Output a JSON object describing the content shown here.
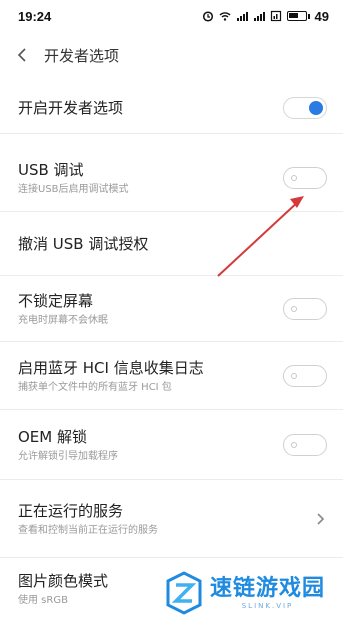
{
  "status_bar": {
    "time": "19:24",
    "battery": "49",
    "icons": [
      "alarm-icon",
      "wifi-icon",
      "signal-icon",
      "signal-icon",
      "signal-icon",
      "battery-icon"
    ]
  },
  "header": {
    "title": "开发者选项",
    "back_icon": "chevron-left-icon"
  },
  "rows": [
    {
      "title": "开启开发者选项",
      "subtitle": "",
      "control": "toggle",
      "on": true
    },
    {
      "title": "USB 调试",
      "subtitle": "连接USB后启用调试模式",
      "control": "toggle",
      "on": false
    },
    {
      "title": "撤消 USB 调试授权",
      "subtitle": "",
      "control": "none"
    },
    {
      "title": "不锁定屏幕",
      "subtitle": "充电时屏幕不会休眠",
      "control": "toggle",
      "on": false
    },
    {
      "title": "启用蓝牙 HCI 信息收集日志",
      "subtitle": "捕获单个文件中的所有蓝牙 HCI 包",
      "control": "toggle",
      "on": false
    },
    {
      "title": "OEM 解锁",
      "subtitle": "允许解锁引导加载程序",
      "control": "toggle",
      "on": false
    },
    {
      "title": "正在运行的服务",
      "subtitle": "查看和控制当前正在运行的服务",
      "control": "chevron"
    },
    {
      "title": "图片颜色模式",
      "subtitle": "使用 sRGB",
      "control": "none"
    }
  ],
  "annotation": {
    "type": "red-arrow",
    "color": "#d43a3a"
  },
  "watermark": {
    "main": "速链游戏园",
    "sub": "SLINK.VIP",
    "color": "#1e8be0"
  }
}
